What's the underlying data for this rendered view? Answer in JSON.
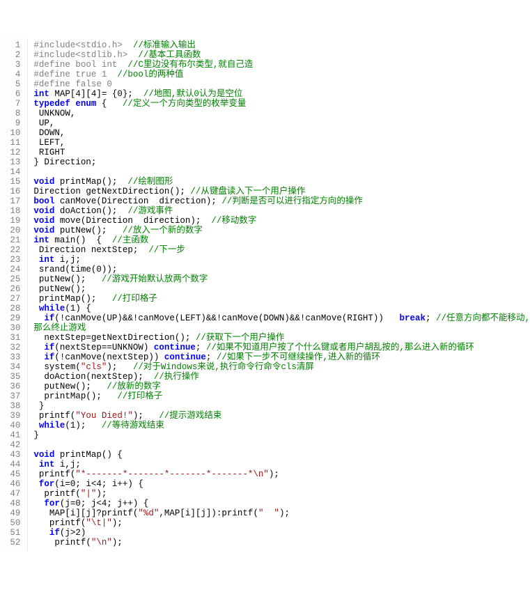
{
  "lines": [
    [
      [
        "pp",
        "#include<stdio.h>  "
      ],
      [
        "comment",
        "//标准输入输出"
      ]
    ],
    [
      [
        "pp",
        "#include<stdlib.h>  "
      ],
      [
        "comment",
        "//基本工具函数"
      ]
    ],
    [
      [
        "pp",
        "#define bool int  "
      ],
      [
        "comment",
        "//C里边没有布尔类型,就自己造"
      ]
    ],
    [
      [
        "pp",
        "#define true 1  "
      ],
      [
        "comment",
        "//bool的两种值"
      ]
    ],
    [
      [
        "pp",
        "#define false 0"
      ]
    ],
    [
      [
        "kw",
        "int"
      ],
      [
        "plain",
        " MAP[4][4]= {0};  "
      ],
      [
        "comment",
        "//地图,默认0认为是空位"
      ]
    ],
    [
      [
        "tkw",
        "typedef"
      ],
      [
        "plain",
        " "
      ],
      [
        "kw",
        "enum"
      ],
      [
        "plain",
        " {   "
      ],
      [
        "comment",
        "//定义一个方向类型的枚举变量"
      ]
    ],
    [
      [
        "plain",
        " UNKNOW,"
      ]
    ],
    [
      [
        "plain",
        " UP,"
      ]
    ],
    [
      [
        "plain",
        " DOWN,"
      ]
    ],
    [
      [
        "plain",
        " LEFT,"
      ]
    ],
    [
      [
        "plain",
        " RIGHT"
      ]
    ],
    [
      [
        "plain",
        "} Direction;"
      ]
    ],
    [
      [
        "plain",
        ""
      ]
    ],
    [
      [
        "kw",
        "void"
      ],
      [
        "plain",
        " printMap();  "
      ],
      [
        "comment",
        "//绘制图形"
      ]
    ],
    [
      [
        "plain",
        "Direction getNextDirection(); "
      ],
      [
        "comment",
        "//从键盘读入下一个用户操作"
      ]
    ],
    [
      [
        "kw",
        "bool"
      ],
      [
        "plain",
        " canMove(Direction  direction); "
      ],
      [
        "comment",
        "//判断是否可以进行指定方向的操作"
      ]
    ],
    [
      [
        "kw",
        "void"
      ],
      [
        "plain",
        " doAction();  "
      ],
      [
        "comment",
        "//游戏事件"
      ]
    ],
    [
      [
        "kw",
        "void"
      ],
      [
        "plain",
        " move(Direction  direction);  "
      ],
      [
        "comment",
        "//移动数字"
      ]
    ],
    [
      [
        "kw",
        "void"
      ],
      [
        "plain",
        " putNew();   "
      ],
      [
        "comment",
        "//放入一个新的数字"
      ]
    ],
    [
      [
        "kw",
        "int"
      ],
      [
        "plain",
        " main()  {  "
      ],
      [
        "comment",
        "//主函数"
      ]
    ],
    [
      [
        "plain",
        " Direction nextStep;  "
      ],
      [
        "comment",
        "//下一步"
      ]
    ],
    [
      [
        "plain",
        " "
      ],
      [
        "kw",
        "int"
      ],
      [
        "plain",
        " i,j;"
      ]
    ],
    [
      [
        "plain",
        " "
      ],
      [
        "fn",
        "srand"
      ],
      [
        "plain",
        "("
      ],
      [
        "fn",
        "time"
      ],
      [
        "plain",
        "(0));"
      ]
    ],
    [
      [
        "plain",
        " putNew();   "
      ],
      [
        "comment",
        "//游戏开始默认放两个数字"
      ]
    ],
    [
      [
        "plain",
        " putNew();"
      ]
    ],
    [
      [
        "plain",
        " printMap();   "
      ],
      [
        "comment",
        "//打印格子"
      ]
    ],
    [
      [
        "plain",
        " "
      ],
      [
        "kw",
        "while"
      ],
      [
        "plain",
        "(1) {"
      ]
    ],
    [
      [
        "plain",
        "  "
      ],
      [
        "kw",
        "if"
      ],
      [
        "plain",
        "(!canMove(UP)&&!canMove(LEFT)&&!canMove(DOWN)&&!canMove(RIGHT))   "
      ],
      [
        "breakw",
        "break"
      ],
      [
        "plain",
        "; "
      ],
      [
        "comment",
        "//任意方向都不能移动,"
      ]
    ],
    [
      [
        "comment",
        "那么终止游戏"
      ]
    ],
    [
      [
        "plain",
        "  nextStep=getNextDirection(); "
      ],
      [
        "comment",
        "//获取下一个用户操作"
      ]
    ],
    [
      [
        "plain",
        "  "
      ],
      [
        "kw",
        "if"
      ],
      [
        "plain",
        "(nextStep==UNKNOW) "
      ],
      [
        "breakw",
        "continue"
      ],
      [
        "plain",
        "; "
      ],
      [
        "comment",
        "//如果不知道用户按了个什么键或者用户胡乱按的,那么进入新的循环"
      ]
    ],
    [
      [
        "plain",
        "  "
      ],
      [
        "kw",
        "if"
      ],
      [
        "plain",
        "(!canMove(nextStep)) "
      ],
      [
        "breakw",
        "continue"
      ],
      [
        "plain",
        "; "
      ],
      [
        "comment",
        "//如果下一步不可继续操作,进入新的循环"
      ]
    ],
    [
      [
        "plain",
        "  "
      ],
      [
        "fn",
        "system"
      ],
      [
        "plain",
        "("
      ],
      [
        "str",
        "\"cls\""
      ],
      [
        "plain",
        ");   "
      ],
      [
        "comment",
        "//对于Windows来说,执行命令行命令cls清屏"
      ]
    ],
    [
      [
        "plain",
        "  doAction(nextStep);  "
      ],
      [
        "comment",
        "//执行操作"
      ]
    ],
    [
      [
        "plain",
        "  putNew();   "
      ],
      [
        "comment",
        "//放新的数字"
      ]
    ],
    [
      [
        "plain",
        "  printMap();   "
      ],
      [
        "comment",
        "//打印格子"
      ]
    ],
    [
      [
        "plain",
        " }"
      ]
    ],
    [
      [
        "plain",
        " "
      ],
      [
        "fn",
        "printf"
      ],
      [
        "plain",
        "("
      ],
      [
        "str",
        "\"You Died!\""
      ],
      [
        "plain",
        ");   "
      ],
      [
        "comment",
        "//提示游戏结束"
      ]
    ],
    [
      [
        "plain",
        " "
      ],
      [
        "kw",
        "while"
      ],
      [
        "plain",
        "(1);   "
      ],
      [
        "comment",
        "//等待游戏结束"
      ]
    ],
    [
      [
        "plain",
        "}"
      ]
    ],
    [
      [
        "plain",
        ""
      ]
    ],
    [
      [
        "kw",
        "void"
      ],
      [
        "plain",
        " printMap() {"
      ]
    ],
    [
      [
        "plain",
        " "
      ],
      [
        "kw",
        "int"
      ],
      [
        "plain",
        " i,j;"
      ]
    ],
    [
      [
        "plain",
        " "
      ],
      [
        "fn",
        "printf"
      ],
      [
        "plain",
        "("
      ],
      [
        "str",
        "\"*-------*-------*-------*-------*\\n\""
      ],
      [
        "plain",
        ");"
      ]
    ],
    [
      [
        "plain",
        " "
      ],
      [
        "kw",
        "for"
      ],
      [
        "plain",
        "(i=0; i<4; i++) {"
      ]
    ],
    [
      [
        "plain",
        "  "
      ],
      [
        "fn",
        "printf"
      ],
      [
        "plain",
        "("
      ],
      [
        "str",
        "\"|\""
      ],
      [
        "plain",
        ");"
      ]
    ],
    [
      [
        "plain",
        "  "
      ],
      [
        "kw",
        "for"
      ],
      [
        "plain",
        "(j=0; j<4; j++) {"
      ]
    ],
    [
      [
        "plain",
        "   MAP[i][j]?"
      ],
      [
        "fn",
        "printf"
      ],
      [
        "plain",
        "("
      ],
      [
        "str",
        "\"%d\""
      ],
      [
        "plain",
        ",MAP[i][j]):"
      ],
      [
        "fn",
        "printf"
      ],
      [
        "plain",
        "("
      ],
      [
        "str",
        "\"  \""
      ],
      [
        "plain",
        ");"
      ]
    ],
    [
      [
        "plain",
        "   "
      ],
      [
        "fn",
        "printf"
      ],
      [
        "plain",
        "("
      ],
      [
        "str",
        "\"\\t|\""
      ],
      [
        "plain",
        ");"
      ]
    ],
    [
      [
        "plain",
        "   "
      ],
      [
        "kw",
        "if"
      ],
      [
        "plain",
        "(j>2)"
      ]
    ],
    [
      [
        "plain",
        "    "
      ],
      [
        "fn",
        "printf"
      ],
      [
        "plain",
        "("
      ],
      [
        "str",
        "\"\\n\""
      ],
      [
        "plain",
        ");"
      ]
    ]
  ]
}
